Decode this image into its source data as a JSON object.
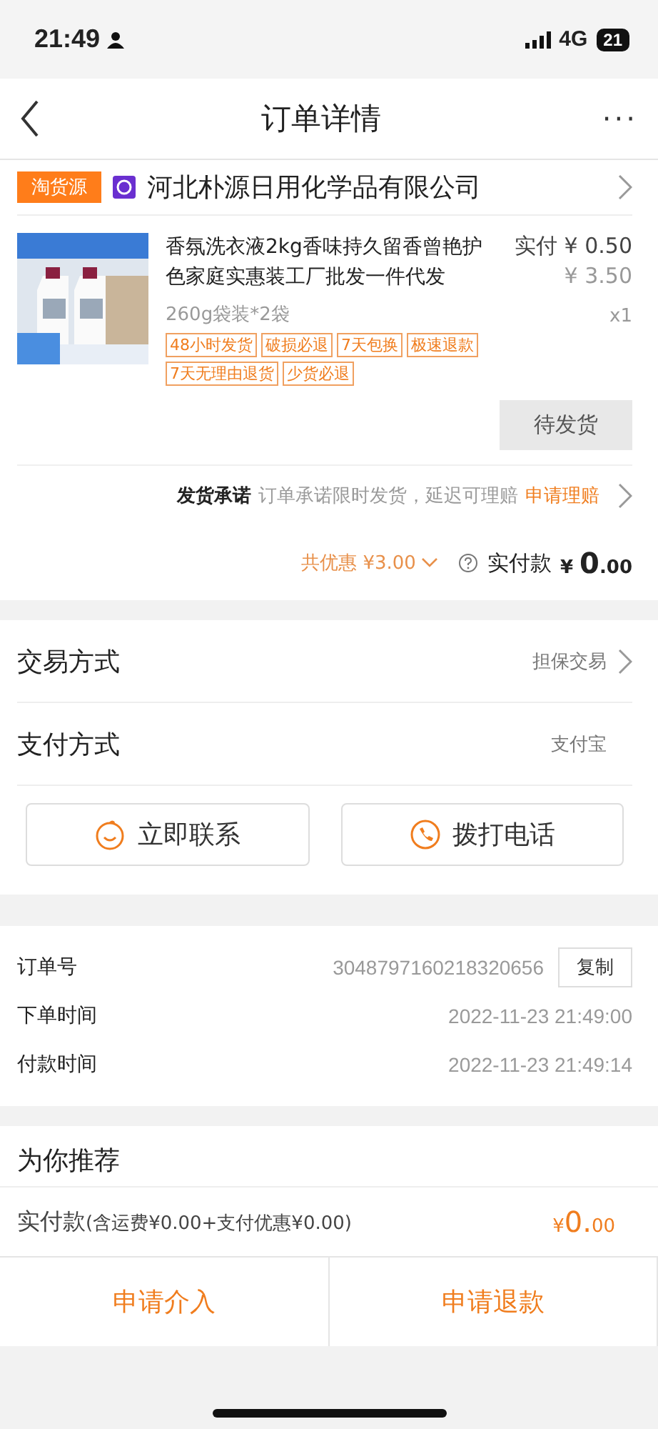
{
  "status_bar": {
    "time": "21:49",
    "network": "4G",
    "battery": "21"
  },
  "header": {
    "title": "订单详情",
    "more": "···"
  },
  "shop": {
    "badge": "淘货源",
    "name": "河北朴源日用化学品有限公司"
  },
  "product": {
    "title": "香氛洗衣液2kg香味持久留香曾艳护色家庭实惠装工厂批发一件代发",
    "paid_label": "实付",
    "paid": "¥ 0.50",
    "original_price": "¥ 3.50",
    "spec": "260g袋装*2袋",
    "quantity": "x1",
    "tags": [
      "48小时发货",
      "破损必退",
      "7天包换",
      "极速退款",
      "7天无理由退货",
      "少货必退"
    ]
  },
  "status_button": "待发货",
  "promise": {
    "label": "发货承诺",
    "text": "订单承诺限时发货，延迟可理赔",
    "link": "申请理赔"
  },
  "summary": {
    "discount": "共优惠 ¥3.00",
    "paid_label": "实付款",
    "currency": "¥",
    "amount": "0",
    "decimals": ".00"
  },
  "methods": [
    {
      "label": "交易方式",
      "value": "担保交易",
      "arrow": true
    },
    {
      "label": "支付方式",
      "value": "支付宝",
      "arrow": false
    }
  ],
  "contact_buttons": [
    {
      "kind": "chat",
      "label": "立即联系"
    },
    {
      "kind": "phone",
      "label": "拨打电话"
    }
  ],
  "order_info": [
    {
      "label": "订单号",
      "value": "3048797160218320656",
      "action": "复制"
    },
    {
      "label": "下单时间",
      "value": "2022-11-23 21:49:00"
    },
    {
      "label": "付款时间",
      "value": "2022-11-23 21:49:14"
    }
  ],
  "recommend_title": "为你推荐",
  "footer": {
    "label": "实付款",
    "note": "(含运费¥0.00+支付优惠¥0.00)",
    "currency": "¥",
    "amount": "0.",
    "decimals": "00"
  },
  "bottom_buttons": [
    "申请介入",
    "申请退款"
  ]
}
